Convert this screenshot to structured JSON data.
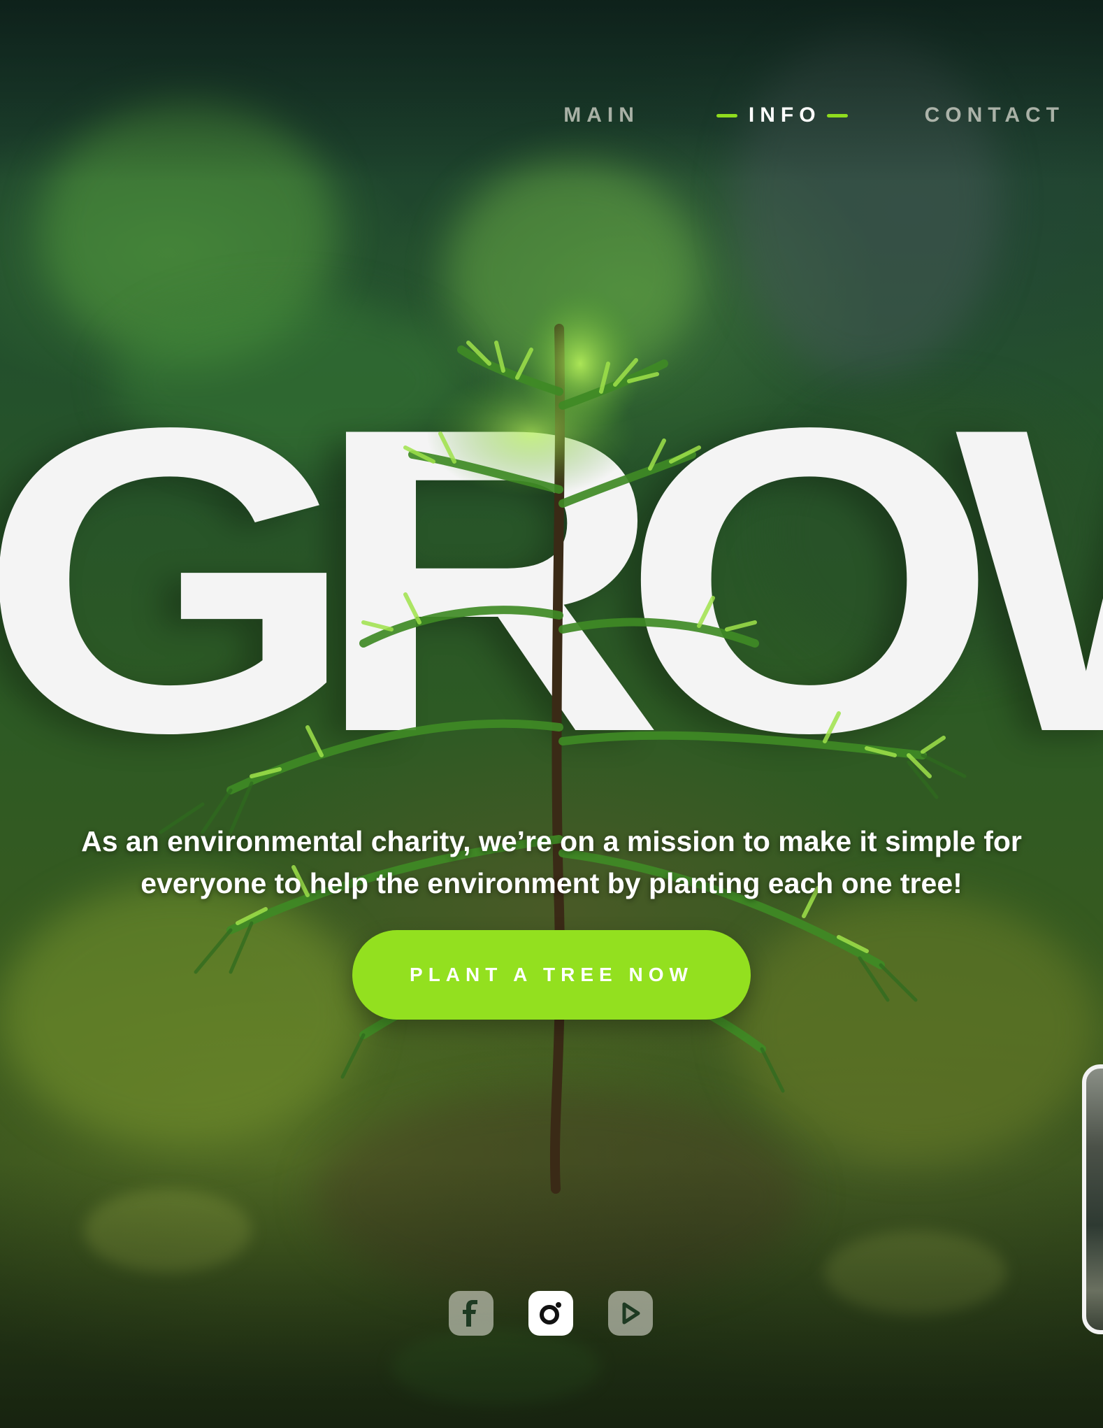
{
  "nav": {
    "items": [
      {
        "label": "MAIN",
        "active": false
      },
      {
        "label": "INFO",
        "active": true
      },
      {
        "label": "CONTACT",
        "active": false
      }
    ]
  },
  "hero": {
    "headline": "GROW",
    "mission": "As an environmental charity, we’re on a mission to make it simple for everyone to help the environment by planting each one tree!",
    "cta_label": "PLANT A TREE NOW"
  },
  "social": {
    "icons": [
      "facebook-icon",
      "instagram-icon",
      "youtube-icon"
    ],
    "active": "instagram-icon"
  },
  "colors": {
    "accent": "#93e01f",
    "text": "#ffffff",
    "nav_muted": "#e1e1d7"
  }
}
